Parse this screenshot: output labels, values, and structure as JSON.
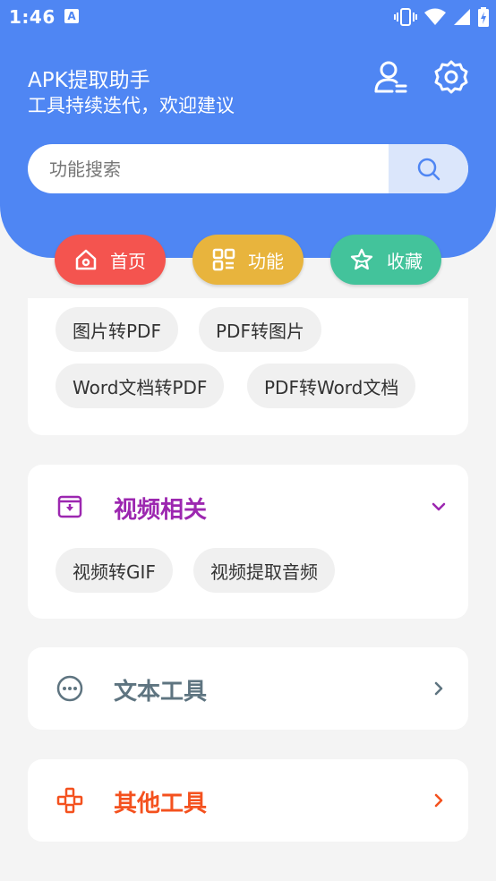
{
  "status": {
    "time": "1:46",
    "notification_icon_letter": "A"
  },
  "header": {
    "title": "APK提取助手",
    "subtitle": "工具持续迭代，欢迎建议"
  },
  "search": {
    "placeholder": "功能搜索",
    "value": ""
  },
  "tabs": [
    {
      "label": "首页",
      "color": "#f4544f"
    },
    {
      "label": "功能",
      "color": "#e8b43d"
    },
    {
      "label": "收藏",
      "color": "#43c39b"
    }
  ],
  "doc_card": {
    "chips": [
      "图片转PDF",
      "PDF转图片",
      "Word文档转PDF",
      "PDF转Word文档"
    ]
  },
  "video_card": {
    "title": "视频相关",
    "color": "#9c27b0",
    "chips": [
      "视频转GIF",
      "视频提取音频"
    ]
  },
  "text_card": {
    "title": "文本工具",
    "color": "#5e7480"
  },
  "other_card": {
    "title": "其他工具",
    "color": "#f4511e"
  },
  "colors": {
    "header": "#4f86f3",
    "background": "#f4f4f4"
  }
}
